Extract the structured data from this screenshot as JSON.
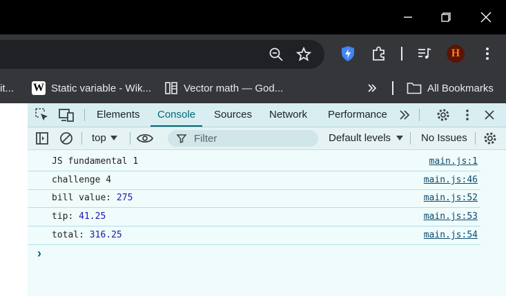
{
  "bookmarks": {
    "items": [
      {
        "label": "it..."
      },
      {
        "label": "Static variable - Wik..."
      },
      {
        "label": "Vector math — God..."
      }
    ],
    "all_label": "All Bookmarks"
  },
  "profile": {
    "initial": "H"
  },
  "devtools": {
    "tabs": [
      "Elements",
      "Console",
      "Sources",
      "Network",
      "Performance"
    ],
    "active_tab": "Console",
    "context": "top",
    "filter_placeholder": "Filter",
    "levels": "Default levels",
    "issues": "No Issues"
  },
  "console": {
    "logs": [
      {
        "text": "JS fundamental 1",
        "value": "",
        "source": "main.js:1"
      },
      {
        "text": "challenge 4",
        "value": "",
        "source": "main.js:46"
      },
      {
        "text": "bill value: ",
        "value": "275",
        "source": "main.js:52"
      },
      {
        "text": "tip: ",
        "value": "41.25",
        "source": "main.js:53"
      },
      {
        "text": "total: ",
        "value": "316.25",
        "source": "main.js:54"
      }
    ],
    "prompt": "›"
  },
  "colors": {
    "accent": "#00687a",
    "console_bg": "#f0fbfb",
    "number": "#1a1aa6"
  }
}
